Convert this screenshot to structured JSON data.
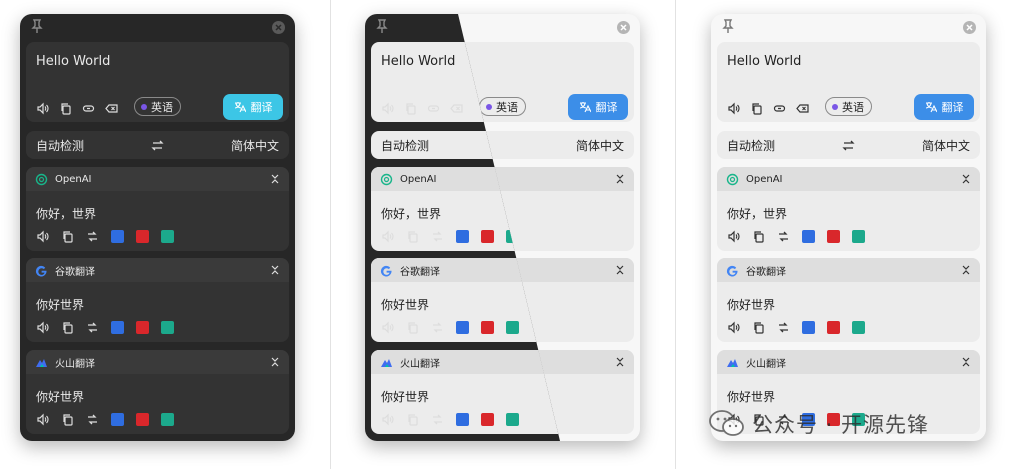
{
  "input": {
    "text": "Hello World",
    "detected_lang": "英语",
    "translate_label": "翻译"
  },
  "lang_bar": {
    "source": "自动检测",
    "target": "简体中文"
  },
  "services": [
    {
      "name": "OpenAI",
      "result": "你好，世界"
    },
    {
      "name": "谷歌翻译",
      "result": "你好世界"
    },
    {
      "name": "火山翻译",
      "result": "你好世界"
    }
  ],
  "icon_names": {
    "pin": "pin-icon",
    "close": "close-icon",
    "speaker": "speaker-icon",
    "copy": "copy-icon",
    "link": "link-icon",
    "clear": "clear-icon",
    "swap": "swap-arrows-icon",
    "collapse": "collapse-icon"
  },
  "colors": {
    "dark_bg": "#272727",
    "light_bg": "#f7f7f7",
    "dark_accent": "#3cc6e6",
    "light_accent": "#3c8ee8",
    "lang_dot": "#7a56e6"
  },
  "watermark": {
    "text": "公众号 · 开源先锋"
  }
}
